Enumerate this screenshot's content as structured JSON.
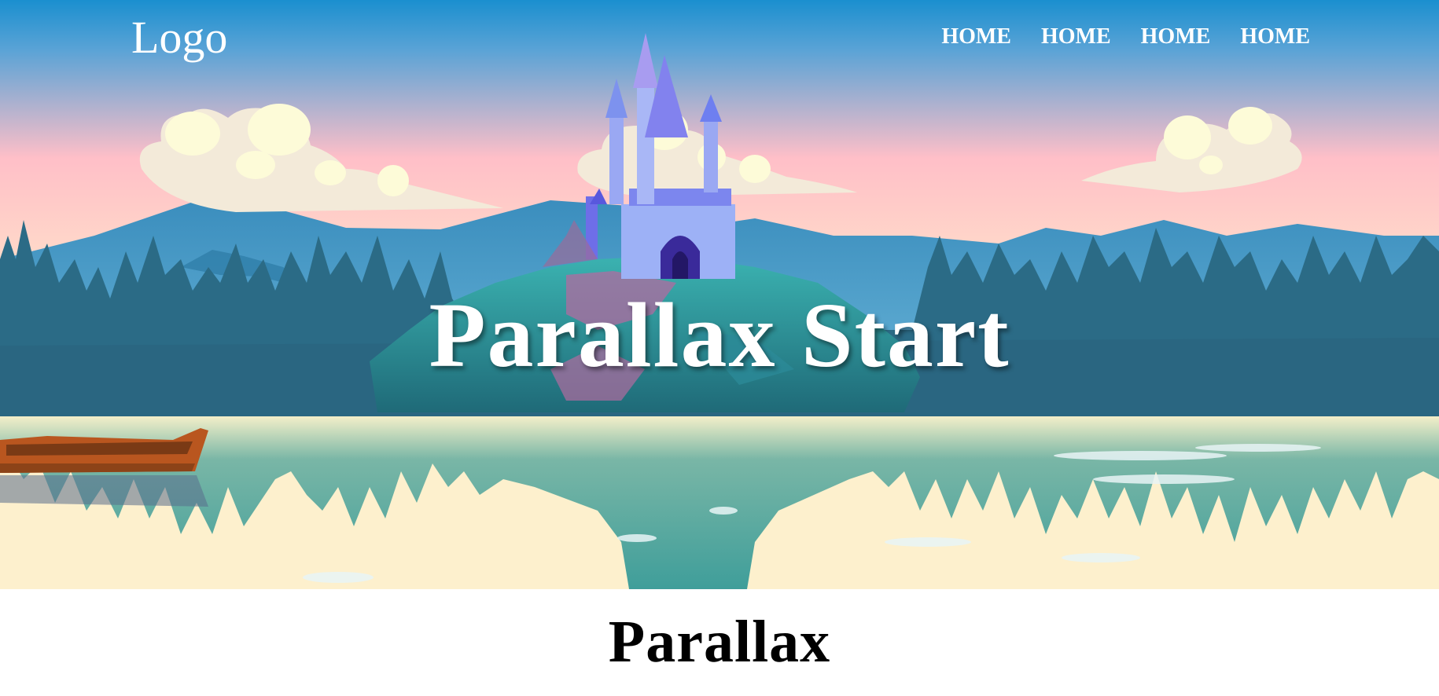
{
  "header": {
    "logo_text": "Logo",
    "nav": [
      {
        "label": "HOME"
      },
      {
        "label": "HOME"
      },
      {
        "label": "HOME"
      },
      {
        "label": "HOME"
      }
    ]
  },
  "hero": {
    "title": "Parallax Start",
    "colors": {
      "sky_top": "#1a8fcf",
      "sky_pink": "#ffb9c4",
      "sky_bottom": "#ffe9c8",
      "mountain": "#3f8fbf",
      "forest": "#2a6a86",
      "water": "#4aa69f",
      "sand": "#fdf0cd",
      "castle": "#8f9cf2",
      "boat": "#b5561f"
    },
    "icons": [
      "castle-illustration",
      "boat-illustration",
      "cloud-illustration"
    ]
  },
  "section": {
    "title": "Parallax"
  }
}
